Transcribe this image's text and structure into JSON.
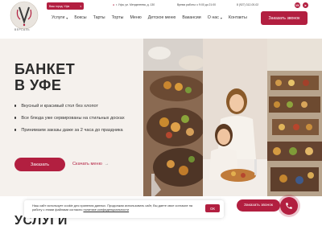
{
  "colors": {
    "accent": "#b21f40",
    "hero_bg": "#f5f1ed",
    "text": "#2a2a2a"
  },
  "header": {
    "logo_text": "ВЕРСАЛЬ",
    "city_select": "Ваш город: Уфа",
    "address": "г. Уфа, ул. Менделеева, д. 130",
    "hours": "Время работы: с 9:00 до 21:00",
    "phone": "8 (927) 312-00-02",
    "social": [
      {
        "icon": "vk-icon",
        "label": "VK"
      },
      {
        "icon": "telegram-icon",
        "label": "➤"
      }
    ],
    "call_button": "Заказать звонок"
  },
  "nav": {
    "items": [
      {
        "label": "Услуги",
        "has_caret": true
      },
      {
        "label": "Боксы",
        "has_caret": false
      },
      {
        "label": "Тарты",
        "has_caret": false
      },
      {
        "label": "Торты",
        "has_caret": false
      },
      {
        "label": "Меню",
        "has_caret": false
      },
      {
        "label": "Детское меню",
        "has_caret": false
      },
      {
        "label": "Вакансии",
        "has_caret": false
      },
      {
        "label": "О нас",
        "has_caret": true
      },
      {
        "label": "Контакты",
        "has_caret": false
      }
    ]
  },
  "hero": {
    "title_line1": "БАНКЕТ",
    "title_line2": "В УФЕ",
    "features": [
      "Вкусный и красивый стол без хлопот",
      "Все блюда уже сервированы на стильных досках",
      "Принимаем заказы даже за 2 часа до праздника"
    ],
    "order_button": "Заказать",
    "menu_link": "Скачать меню",
    "menu_link_arrow": "→"
  },
  "cookie": {
    "text": "Наш сайт использует cookie для хранения данных. Продолжая использовать сайт, Вы даете свое согласие на работу с этими файлами согласно ",
    "policy_link": "политике конфиденциальности",
    "ok_button": "ОК"
  },
  "services_title": "УСЛУГИ",
  "floating": {
    "call_button": "Заказать звонок",
    "phone_icon": "phone-icon"
  }
}
